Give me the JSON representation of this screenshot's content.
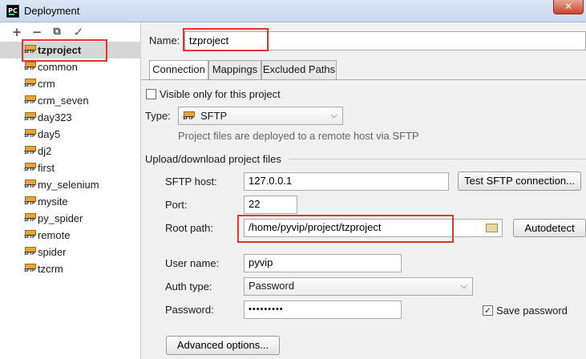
{
  "window": {
    "title": "Deployment",
    "app_icon": "PC"
  },
  "sidebar": {
    "toolbar": {
      "add": "+",
      "remove": "−",
      "copy": "⧉",
      "apply": "✓"
    },
    "icon_label": "SFTP",
    "servers": [
      "tzproject",
      "common",
      "crm",
      "crm_seven",
      "day323",
      "day5",
      "dj2",
      "first",
      "my_selenium",
      "mysite",
      "py_spider",
      "remote",
      "spider",
      "tzcrm"
    ],
    "selected": "tzproject"
  },
  "form": {
    "name_label": "Name:",
    "name_value": "tzproject",
    "tabs": [
      "Connection",
      "Mappings",
      "Excluded Paths"
    ],
    "active_tab": "Connection",
    "visible_only_label": "Visible only for this project",
    "visible_only_checked": false,
    "type_label": "Type:",
    "type_value": "SFTP",
    "type_description": "Project files are deployed to a remote host via SFTP",
    "section_title": "Upload/download project files",
    "sftp_host_label": "SFTP host:",
    "sftp_host_value": "127.0.0.1",
    "test_button": "Test SFTP connection...",
    "port_label": "Port:",
    "port_value": "22",
    "root_path_label": "Root path:",
    "root_path_value": "/home/pyvip/project/tzproject",
    "autodetect_button": "Autodetect",
    "username_label": "User name:",
    "username_value": "pyvip",
    "auth_type_label": "Auth type:",
    "auth_type_value": "Password",
    "password_label": "Password:",
    "password_value": "•••••••••",
    "save_password_label": "Save password",
    "save_password_checked": true,
    "advanced_button": "Advanced options..."
  },
  "colors": {
    "highlight": "#e8322b",
    "selection": "#d6d6d6",
    "sftp_icon": "#e6a43c"
  }
}
